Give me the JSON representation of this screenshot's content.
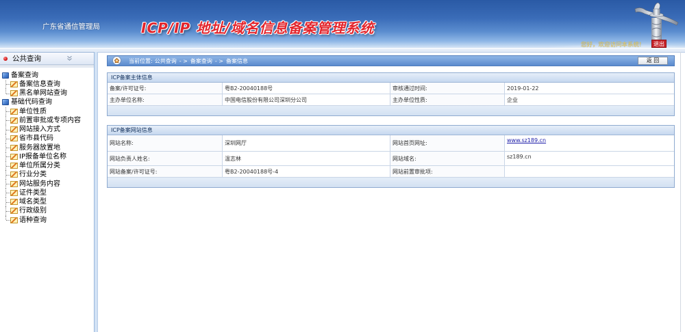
{
  "header": {
    "org_name": "广东省通信管理局",
    "system_title": "ICP/IP 地址/域名信息备案管理系统",
    "welcome": "您好，欢迎访问本系统!",
    "logout_label": "退出"
  },
  "sidebar": {
    "section_title": "公共查询",
    "groups": [
      {
        "label": "备案查询",
        "items": [
          {
            "label": "备案信息查询"
          },
          {
            "label": "黑名单网站查询"
          }
        ]
      },
      {
        "label": "基础代码查询",
        "items": [
          {
            "label": "单位性质"
          },
          {
            "label": "前置审批或专项内容"
          },
          {
            "label": "网站接入方式"
          },
          {
            "label": "省市县代码"
          },
          {
            "label": "服务器放置地"
          },
          {
            "label": "IP报备单位名称"
          },
          {
            "label": "单位所属分类"
          },
          {
            "label": "行业分类"
          },
          {
            "label": "网站服务内容"
          },
          {
            "label": "证件类型"
          },
          {
            "label": "域名类型"
          },
          {
            "label": "行政级别"
          },
          {
            "label": "语种查询"
          }
        ]
      }
    ]
  },
  "breadcrumb": {
    "location_label": "当前位置:",
    "crumbs": [
      "公共查询",
      "备案查询",
      "备案信息"
    ],
    "separator": "- >",
    "back_label": "返 回"
  },
  "panels": {
    "subject": {
      "title": "ICP备案主体信息",
      "rows": [
        {
          "label1": "备案/许可证号:",
          "value1": "粤B2-20040188号",
          "label2": "审核通过时间:",
          "value2": "2019-01-22"
        },
        {
          "label1": "主办单位名称:",
          "value1": "中国电信股份有限公司深圳分公司",
          "label2": "主办单位性质:",
          "value2": "企业"
        }
      ]
    },
    "website": {
      "title": "ICP备案网站信息",
      "rows": [
        {
          "label1": "网站名称:",
          "value1": "深圳网厅",
          "label2": "网站首页网址:",
          "value2": "www.sz189.cn"
        },
        {
          "label1": "网站负责人姓名:",
          "value1": "温志林",
          "label2": "网站域名:",
          "value2": "sz189.cn"
        },
        {
          "label1": "网站备案/许可证号:",
          "value1": "粤B2-20040188号-4",
          "label2": "网站前置审批项:"
        }
      ]
    }
  },
  "icons": {
    "banner": "huabiao-monument-icon",
    "section": "red-dot-icon",
    "collapse": "double-chevron-down-icon",
    "group": "folder-group-icon",
    "item": "edit-page-icon",
    "breadcrumb": "home-icon"
  },
  "theme": {
    "banner_blue": "#2a5aa5",
    "title_red": "#e3252c",
    "logout_red": "#c7232a",
    "welcome_yellow": "#f2d25c",
    "link_blue": "#1b1ba8"
  }
}
